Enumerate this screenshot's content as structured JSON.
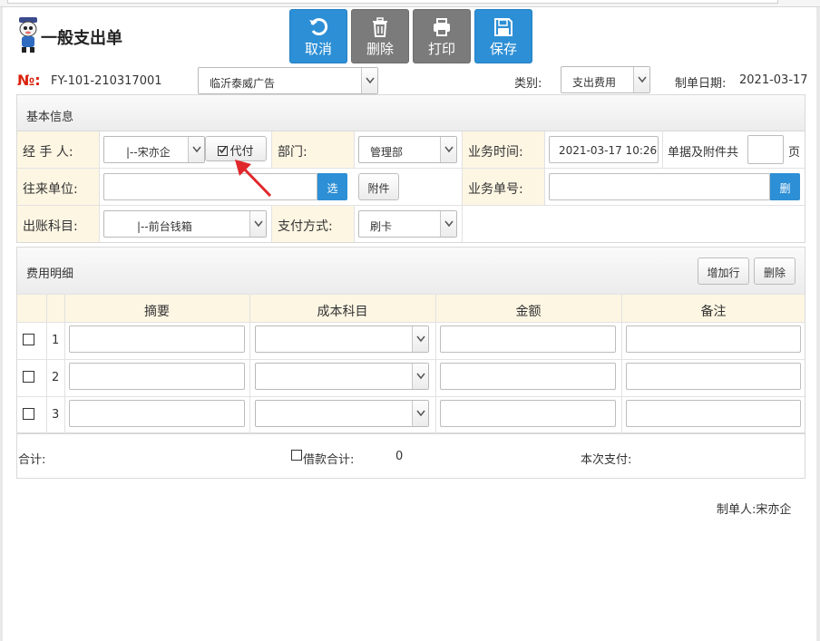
{
  "header": {
    "title": "一般支出单",
    "toolbar": [
      {
        "label": "取消",
        "icon": "refresh-icon"
      },
      {
        "label": "删除",
        "icon": "trash-icon"
      },
      {
        "label": "打印",
        "icon": "printer-icon"
      },
      {
        "label": "保存",
        "icon": "save-icon"
      }
    ]
  },
  "doc": {
    "no_mark": "№:",
    "no": "FY-101-210317001",
    "company": "临沂泰威广告",
    "category_label": "类别:",
    "category": "支出费用",
    "date_label": "制单日期:",
    "date": "2021-03-17"
  },
  "basic": {
    "section_title": "基本信息",
    "handler_label": "经 手 人:",
    "handler": "|--宋亦企",
    "daifu_label": "代付",
    "dept_label": "部门:",
    "dept": "管理部",
    "biz_time_label": "业务时间:",
    "biz_time": "2021-03-17 10:26",
    "attach_count_label": "单据及附件共",
    "attach_count": "",
    "attach_unit": "页",
    "partner_label": "往来单位:",
    "partner": "",
    "select_btn": "选",
    "attach_btn": "附件",
    "biz_no_label": "业务单号:",
    "biz_no": "",
    "delete_btn": "删",
    "account_label": "出账科目:",
    "account": "|--前台钱箱",
    "pay_label": "支付方式:",
    "pay": "刷卡"
  },
  "detail": {
    "section_title": "费用明细",
    "add_row_btn": "增加行",
    "delete_btn": "删除",
    "columns": [
      "摘要",
      "成本科目",
      "金额",
      "备注"
    ],
    "rows": [
      {
        "num": "1",
        "summary": "",
        "subject": "",
        "amount": "",
        "note": ""
      },
      {
        "num": "2",
        "summary": "",
        "subject": "",
        "amount": "",
        "note": ""
      },
      {
        "num": "3",
        "summary": "",
        "subject": "",
        "amount": "",
        "note": ""
      }
    ]
  },
  "footer": {
    "total_label": "合计:",
    "loan_label": "借款合计:",
    "loan_value": "0",
    "this_pay_label": "本次支付:",
    "maker": "制单人:宋亦企"
  },
  "colors": {
    "primary_blue": "#2d8fd5",
    "gray_button": "#7b7b7b",
    "label_bg": "#fdf6e3",
    "doc_mark_red": "#d9220d",
    "arrow_red": "#e0272b"
  }
}
